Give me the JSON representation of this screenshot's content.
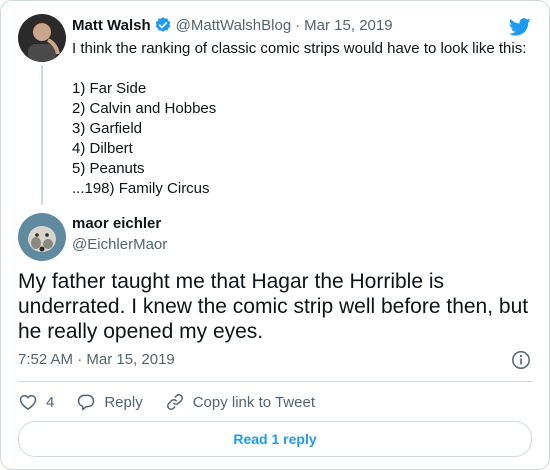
{
  "parent_tweet": {
    "name": "Matt Walsh",
    "handle": "@MattWalshBlog",
    "separator": "·",
    "date": "Mar 15, 2019",
    "text": "I think the ranking of classic comic strips would have to look like this:\n\n1) Far Side\n2) Calvin and Hobbes\n3) Garfield\n4) Dilbert\n5) Peanuts\n...198) Family Circus",
    "verified_icon": "verified-badge-icon",
    "avatar_icon": "avatar"
  },
  "reply_tweet": {
    "name": "maor eichler",
    "handle": "@EichlerMaor",
    "text": "My father taught me that Hagar the Horrible is underrated. I knew the comic strip well before then, but he really opened my eyes.",
    "timestamp": "7:52 AM · Mar 15, 2019"
  },
  "actions": {
    "like_count": "4",
    "reply_label": "Reply",
    "copy_link_label": "Copy link to Tweet"
  },
  "read_replies_label": "Read 1 reply",
  "colors": {
    "accent": "#1d9bf0",
    "text": "#0f1419",
    "muted": "#536471",
    "border": "#cfd9de"
  }
}
